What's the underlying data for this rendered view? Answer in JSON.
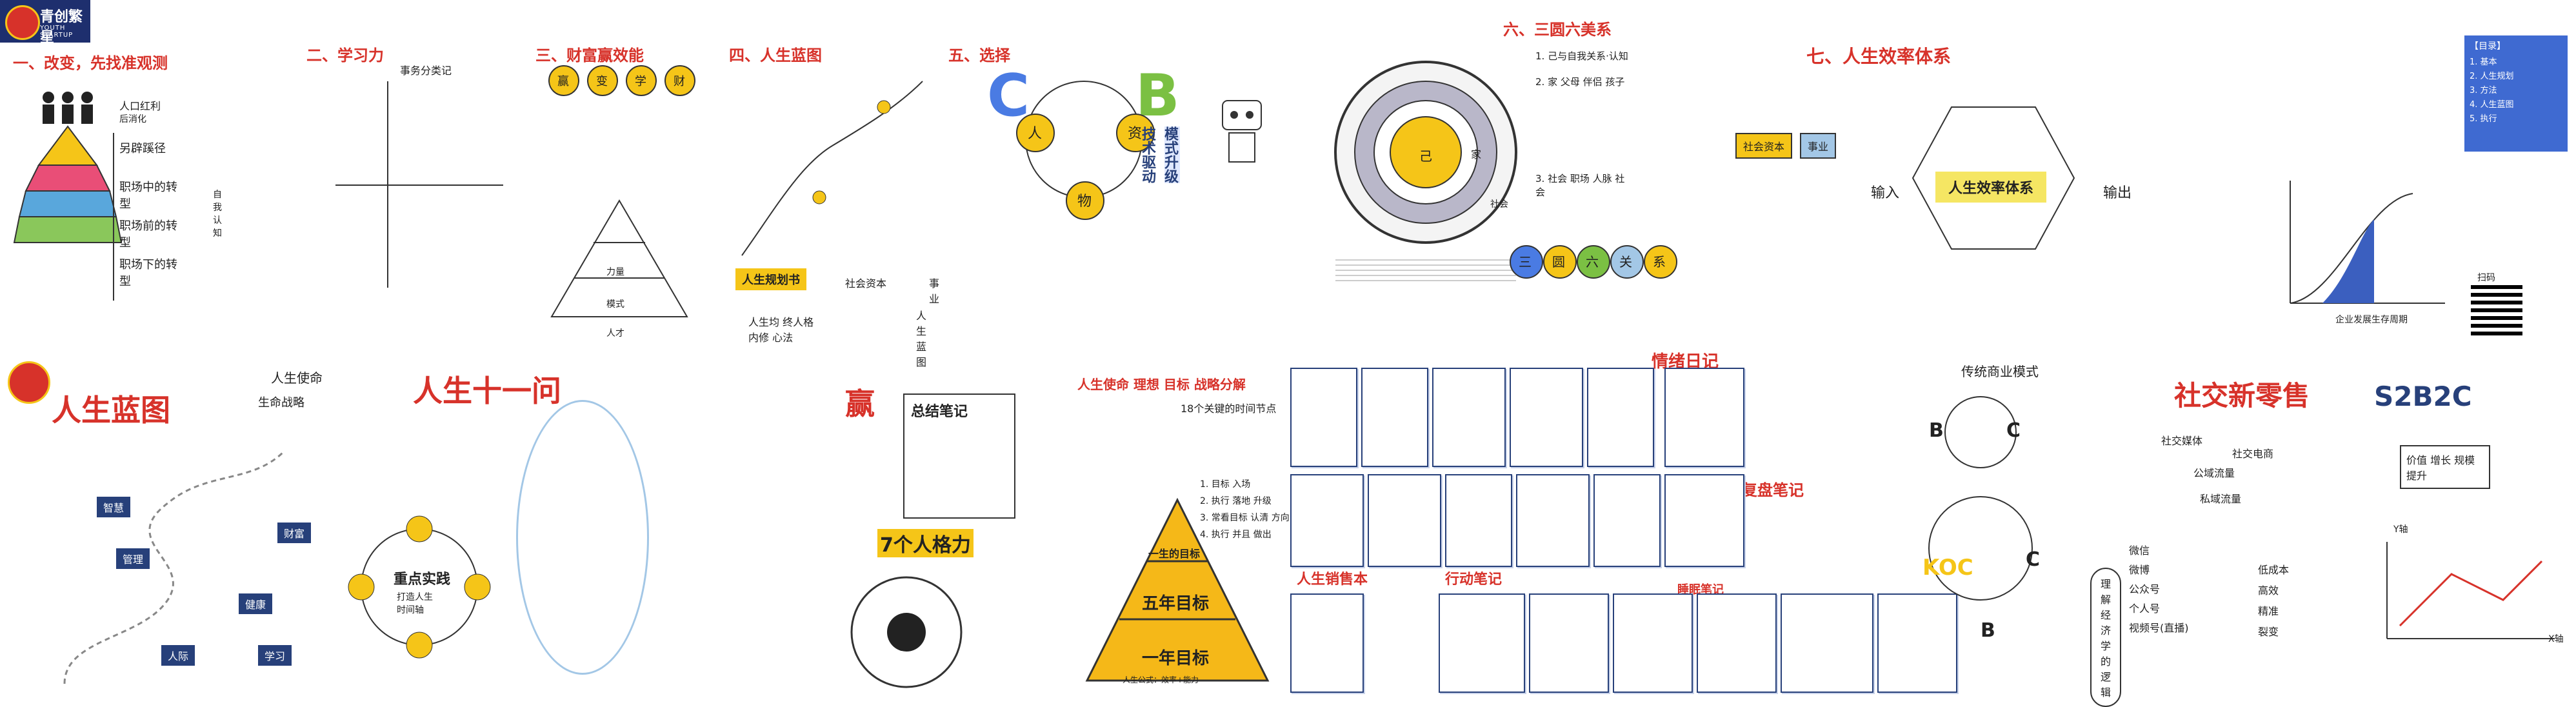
{
  "logo": {
    "name": "青创繁星",
    "sub": "YOUTH STARTUP"
  },
  "row1": {
    "s1_title": "一、改变，先找准观测",
    "s1_items": [
      "人口红利",
      "后消化",
      "另辟蹊径",
      "职场中的转型",
      "职场前的转型",
      "职场下的转型",
      "自我认知"
    ],
    "s2_title": "二、学习力",
    "s2_caption": "事务分类记",
    "s3_title": "三、财富赢效能",
    "s3_circles": [
      "赢",
      "变",
      "学",
      "财"
    ],
    "s3_pyramid": [
      "力量",
      "模式",
      "人才"
    ],
    "s4_title": "四、人生蓝图",
    "s4_labels": [
      "人生规划书",
      "人生蓝图",
      "社会资本",
      "事业"
    ],
    "s4_note": "人生均 终人格\n内修 心法",
    "s5_title": "五、选择",
    "s5_letters": [
      "C",
      "B"
    ],
    "s5_circles": [
      "人",
      "资",
      "物"
    ],
    "s5_vertical": [
      "技术驱动",
      "模式升级"
    ],
    "s6_title": "六、三圆六美系",
    "s6_rings": [
      "家",
      "社会",
      "己"
    ],
    "s6_chips": [
      "三",
      "圆",
      "六",
      "关",
      "系"
    ],
    "s6_lists": [
      "1. 己与自我关系·认知",
      "2. 家 父母 伴侣 孩子",
      "3. 社会 职场 人脉 社会"
    ],
    "s7_title": "七、人生效率体系",
    "s7_center": "人生效率体系",
    "s7_io": [
      "输入",
      "输出"
    ],
    "s7_flow": [
      "社会资本",
      "事业"
    ],
    "s8_info": [
      "【目录】",
      "1. 基本",
      "2. 人生规划",
      "3. 方法",
      "4. 人生蓝图",
      "5. 执行"
    ],
    "s8_chart_label": "企业发展生存周期",
    "s8_qr_label": "扫码"
  },
  "row2": {
    "r1_title": "人生蓝图",
    "r1_note1": "人生使命",
    "r1_note2": "生命战略",
    "r1_signs": [
      "智慧",
      "管理",
      "财富",
      "健康",
      "人际",
      "学习"
    ],
    "r2_title": "人生十一问",
    "r2_center": "重点实践",
    "r2_sub": "打造人生\n时间轴",
    "r3_title": "赢",
    "r3_box_title": "总结笔记",
    "r3_bold": "7个人格力",
    "r4_title": "人生使命 理想 目标 战略分解",
    "r4_box": "18个关键的时间节点",
    "r4_pyramid": [
      "一生的目标",
      "五年目标",
      "一年目标"
    ],
    "r4_steps": [
      "1. 目标 入场",
      "2. 执行 落地 升级",
      "3. 常看目标 认清 方向",
      "4. 执行 并且 做出"
    ],
    "r4_pyr_caption": "人生公式：效率+能力",
    "r5_red_title": "情绪日记",
    "r5_sub_title": "复盘笔记",
    "r5_bottom_left": "人生销售本",
    "r5_bottom_mid": "行动笔记",
    "r5_bottom_mid2": "睡眠笔记",
    "r6_title": "传统商业模式",
    "r6_letters": [
      "B",
      "C",
      "KOC",
      "B",
      "C"
    ],
    "r6_bubble": "理解经济学的逻辑",
    "r7_title": "社交新零售",
    "r7_tag": "S2B2C",
    "r7_labels": [
      "社交媒体",
      "社交电商",
      "公域流量",
      "私域流量"
    ],
    "r7_axes": [
      "Y轴",
      "X轴"
    ],
    "r7_right_box": "价值 增长 规模 提升",
    "r7_left_list": [
      "微信",
      "微博",
      "公众号",
      "个人号",
      "视频号(直播)"
    ],
    "r7_mid_list": [
      "低成本",
      "高效",
      "精准",
      "裂变"
    ]
  },
  "colors": {
    "accent_yellow": "#f5c518",
    "accent_red": "#d7322a",
    "navy": "#27407a",
    "logo_bg": "#1e2f6e"
  }
}
